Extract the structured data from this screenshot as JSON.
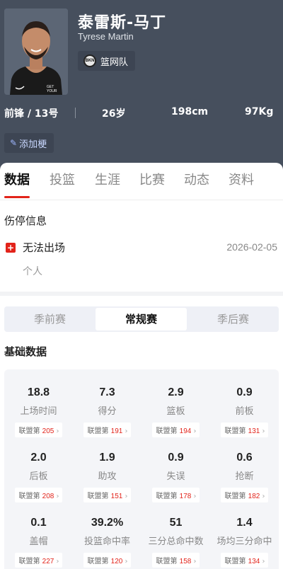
{
  "player": {
    "name_cn": "泰雷斯-马丁",
    "name_en": "Tyrese Martin",
    "team": "篮网队",
    "team_logo_text": "BKN",
    "position_number": "前锋 / 13号",
    "age": "26岁",
    "height": "198cm",
    "weight": "97Kg",
    "add_button": "添加梗"
  },
  "tabs": [
    "数据",
    "投篮",
    "生涯",
    "比赛",
    "动态",
    "资料"
  ],
  "injury": {
    "title": "伤停信息",
    "status": "无法出场",
    "date": "2026-02-05",
    "reason": "个人"
  },
  "season_tabs": [
    "季前赛",
    "常规赛",
    "季后赛"
  ],
  "active_season_tab": "常规赛",
  "basic_title": "基础数据",
  "rank_prefix": "联盟第",
  "stats": [
    {
      "value": "18.8",
      "label": "上场时间",
      "rank": "205"
    },
    {
      "value": "7.3",
      "label": "得分",
      "rank": "191"
    },
    {
      "value": "2.9",
      "label": "篮板",
      "rank": "194"
    },
    {
      "value": "0.9",
      "label": "前板",
      "rank": "131"
    },
    {
      "value": "2.0",
      "label": "后板",
      "rank": "208"
    },
    {
      "value": "1.9",
      "label": "助攻",
      "rank": "151"
    },
    {
      "value": "0.9",
      "label": "失误",
      "rank": "178"
    },
    {
      "value": "0.6",
      "label": "抢断",
      "rank": "182"
    },
    {
      "value": "0.1",
      "label": "盖帽",
      "rank": "227"
    },
    {
      "value": "39.2%",
      "label": "投篮命中率",
      "rank": "120"
    },
    {
      "value": "51",
      "label": "三分总命中数",
      "rank": "158"
    },
    {
      "value": "1.4",
      "label": "场均三分命中",
      "rank": "134"
    }
  ],
  "colors": {
    "header_bg": "#464f5d",
    "accent_red": "#e2231a"
  }
}
